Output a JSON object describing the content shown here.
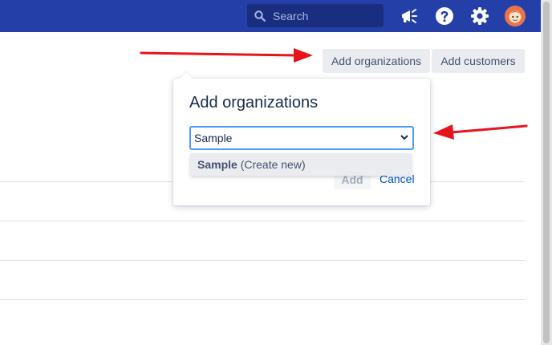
{
  "topbar": {
    "search_placeholder": "Search",
    "icons": [
      "announcement-icon",
      "help-icon",
      "settings-icon",
      "avatar"
    ]
  },
  "actions": {
    "add_organizations": "Add organizations",
    "add_customers": "Add customers"
  },
  "popup": {
    "title": "Add organizations",
    "field_value": "Sample",
    "add_label": "Add",
    "cancel_label": "Cancel"
  },
  "dropdown": {
    "option_bold": "Sample",
    "option_suffix": " (Create new)"
  },
  "colors": {
    "topbar": "#243fa8",
    "arrow": "#e8141b",
    "field_border": "#4c9aff",
    "link": "#0052cc"
  }
}
